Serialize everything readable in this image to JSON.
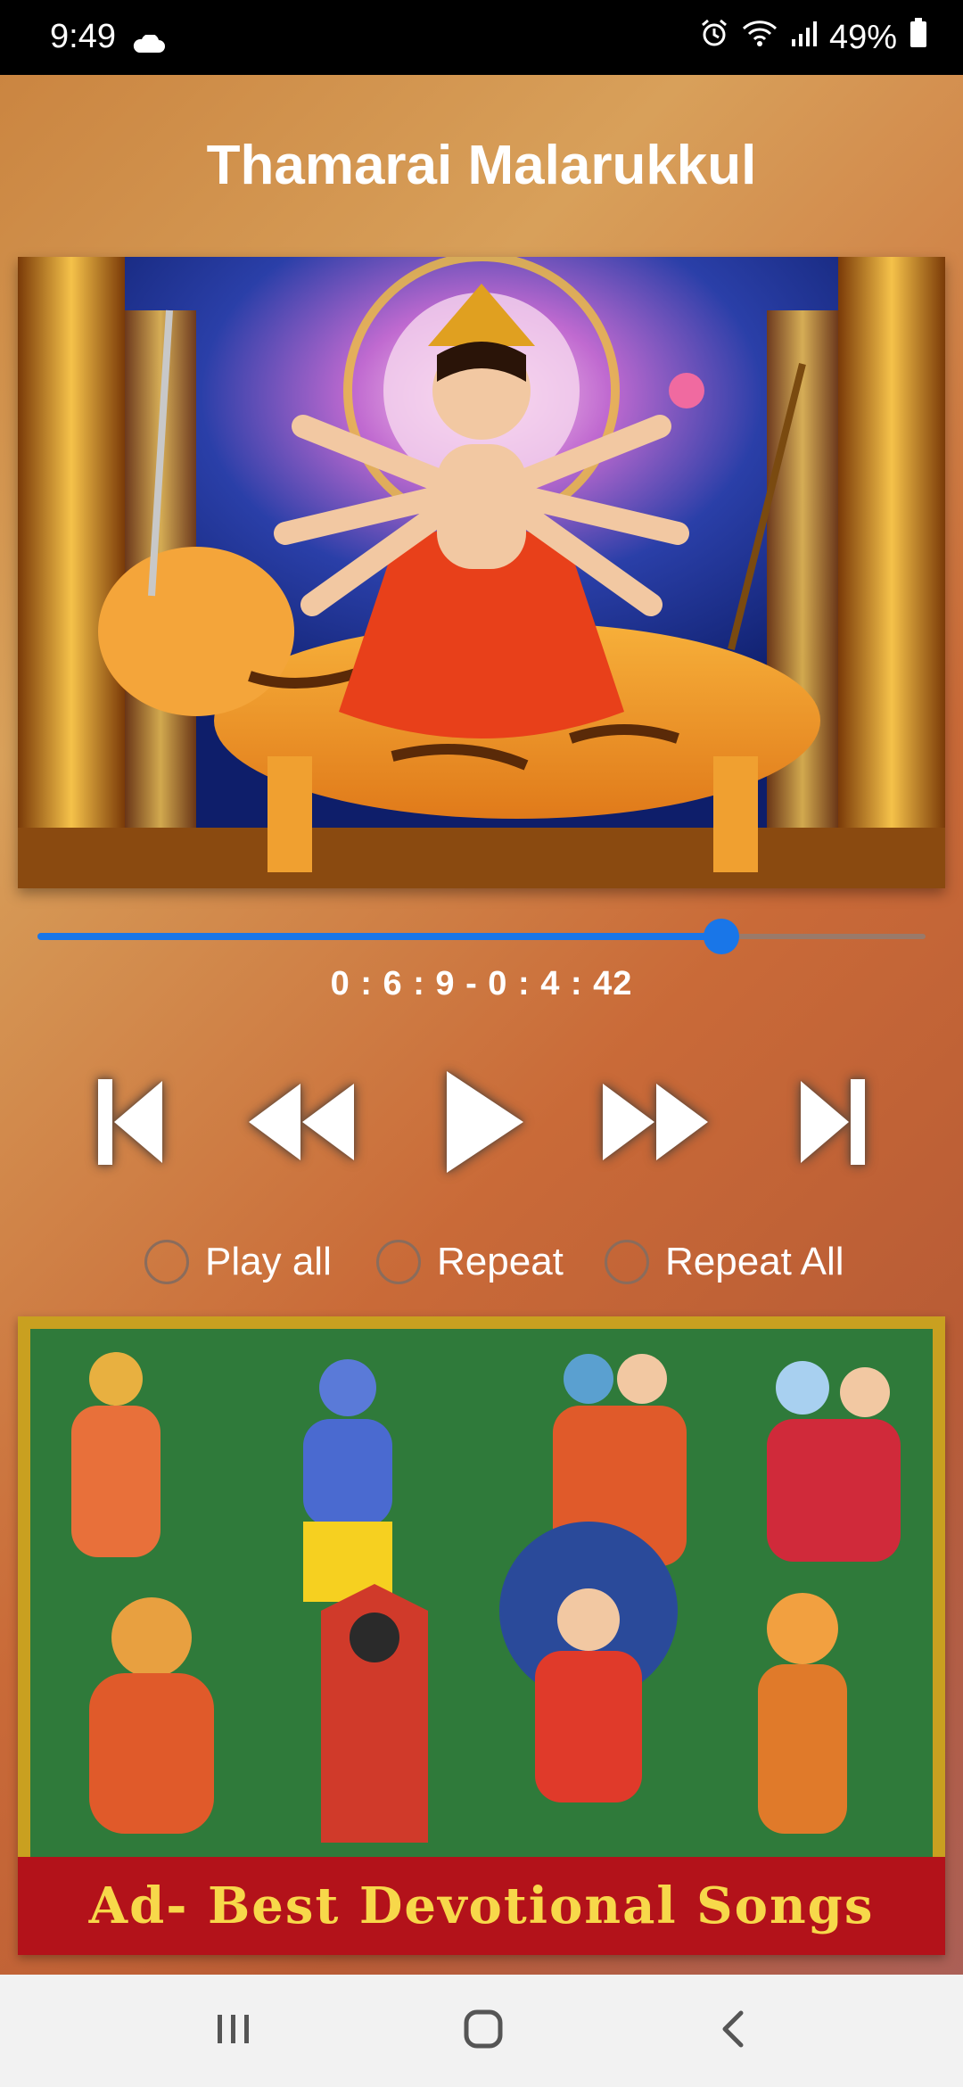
{
  "status_bar": {
    "time": "9:49",
    "battery": "49%",
    "icons": [
      "cloud-icon",
      "alarm-icon",
      "wifi-icon",
      "signal-icon",
      "battery-icon"
    ]
  },
  "player": {
    "title": "Thamarai Malarukkul",
    "album_art": "goddess-durga-on-tiger-image",
    "time_display": "0 : 6 : 9 - 0 : 4 : 42",
    "progress": 0.77,
    "accent_color": "#1976e8"
  },
  "controls": {
    "icons": [
      "skip-previous-icon",
      "rewind-icon",
      "play-icon",
      "fast-forward-icon",
      "skip-next-icon"
    ]
  },
  "options": [
    {
      "label": "Play all",
      "checked": false
    },
    {
      "label": "Repeat",
      "checked": false
    },
    {
      "label": "Repeat All",
      "checked": false
    }
  ],
  "ad": {
    "caption": "Ad- Best Devotional Songs",
    "image": "hindu-deities-collage-image"
  },
  "nav": {
    "icons": [
      "recent-apps-icon",
      "home-icon",
      "back-icon"
    ]
  }
}
